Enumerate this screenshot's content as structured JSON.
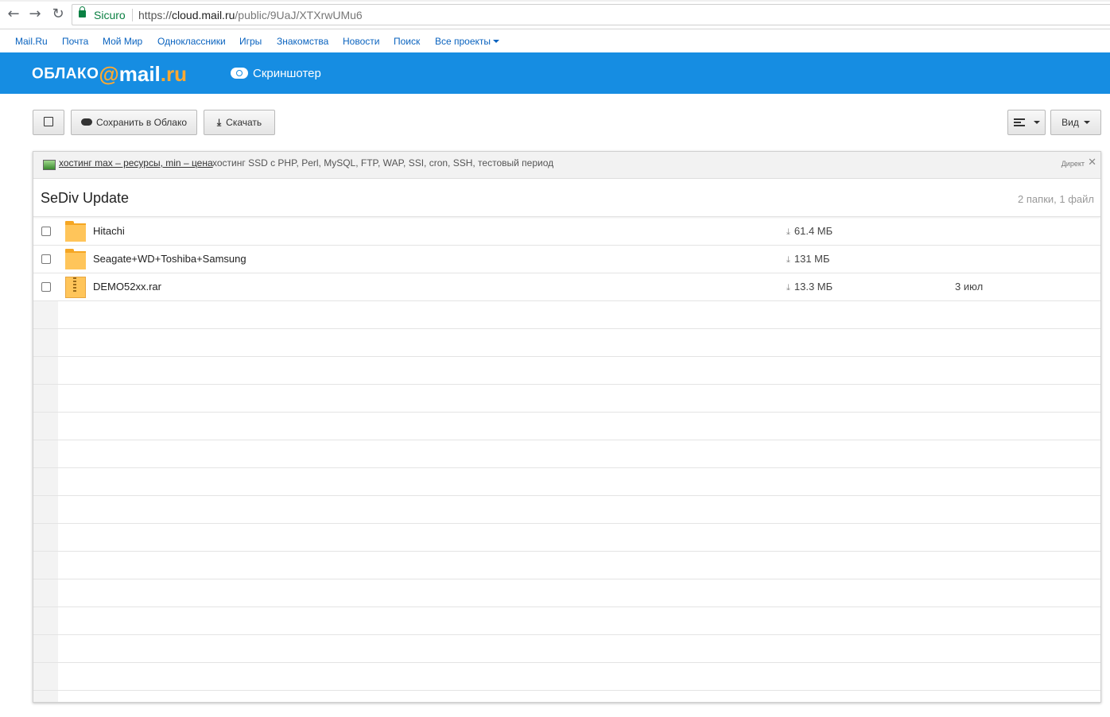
{
  "browser": {
    "secure_label": "Sicuro",
    "url_scheme": "https://",
    "url_host": "cloud.mail.ru",
    "url_path": "/public/9UaJ/XTXrwUMu6"
  },
  "portal": {
    "links": [
      "Mail.Ru",
      "Почта",
      "Мой Мир",
      "Одноклассники",
      "Игры",
      "Знакомства",
      "Новости",
      "Поиск",
      "Все проекты"
    ]
  },
  "header": {
    "logo_word": "ОБЛАКО",
    "logo_at": "@",
    "logo_mail": "mail",
    "logo_ru": ".ru",
    "screenshoter": "Скриншотер"
  },
  "toolbar": {
    "save_label": "Сохранить в Облако",
    "download_label": "Скачать",
    "view_label": "Вид"
  },
  "ad": {
    "link_text": "хостинг max – ресурсы, min – цена",
    "text": "хостинг SSD с PHP, Perl, MySQL, FTP, WAP, SSI, cron, SSH, тестовый период",
    "label": "Директ",
    "close": "✕"
  },
  "folder": {
    "title": "SeDiv Update",
    "count": "2 папки, 1 файл"
  },
  "items": [
    {
      "name": "Hitachi",
      "type": "folder",
      "size": "61.4 МБ",
      "date": ""
    },
    {
      "name": "Seagate+WD+Toshiba+Samsung",
      "type": "folder",
      "size": "131 МБ",
      "date": ""
    },
    {
      "name": "DEMO52xx.rar",
      "type": "archive",
      "size": "13.3 МБ",
      "date": "3 июл"
    }
  ],
  "colors": {
    "header_blue": "#168de2",
    "logo_accent": "#ffa930",
    "link_blue": "#0a63bf",
    "folder_yellow": "#ffc55a"
  }
}
